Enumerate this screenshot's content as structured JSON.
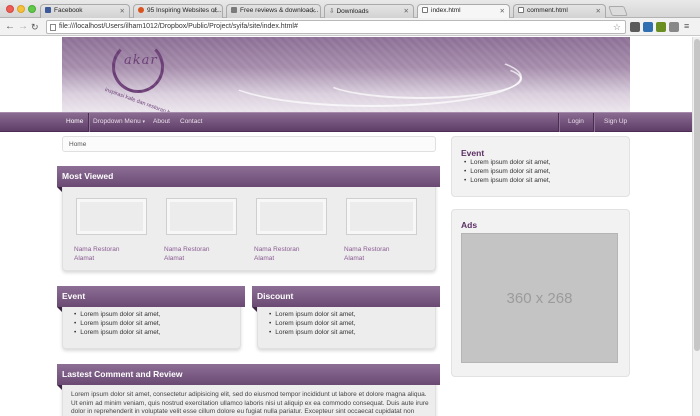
{
  "browser": {
    "tabs": [
      {
        "label": "Facebook",
        "icon": "facebook-icon",
        "color": "#3b5998"
      },
      {
        "label": "95 Inspiring Websites of...",
        "icon": "web-icon",
        "color": "#d9531e"
      },
      {
        "label": "Free reviews & download...",
        "icon": "web-icon",
        "color": "#7a7a7a"
      },
      {
        "label": "Downloads",
        "icon": "download-icon",
        "color": "#555555"
      },
      {
        "label": "index.html",
        "icon": "page-icon",
        "color": "#777777"
      },
      {
        "label": "comment.html",
        "icon": "page-icon",
        "color": "#777777"
      }
    ],
    "url": "file:///localhost/Users/ilham1012/Dropbox/Public/Project/syifa/site/index.html#"
  },
  "site": {
    "logo_text": "akar",
    "logo_tagline": "inspirasi kafe dan restoran bandung",
    "nav": {
      "home": "Home",
      "dropdown": "Dropdown Menu",
      "about": "About",
      "contact": "Contact",
      "login": "Login",
      "signup": "Sign Up"
    },
    "breadcrumb": "Home",
    "most_viewed": {
      "title": "Most Viewed",
      "items": [
        {
          "name": "Nama Restoran",
          "address": "Alamat"
        },
        {
          "name": "Nama Restoran",
          "address": "Alamat"
        },
        {
          "name": "Nama Restoran",
          "address": "Alamat"
        },
        {
          "name": "Nama Restoran",
          "address": "Alamat"
        }
      ]
    },
    "event": {
      "title": "Event",
      "items": [
        "Lorem ipsum dolor sit amet,",
        "Lorem ipsum dolor sit amet,",
        "Lorem ipsum dolor sit amet,"
      ]
    },
    "discount": {
      "title": "Discount",
      "items": [
        "Lorem ipsum dolor sit amet,",
        "Lorem ipsum dolor sit amet,",
        "Lorem ipsum dolor sit amet,"
      ]
    },
    "latest": {
      "title": "Lastest Comment and Review",
      "text": "Lorem ipsum dolor sit amet, consectetur adipisicing elit, sed do eiusmod tempor incididunt ut labore et dolore magna aliqua. Ut enim ad minim veniam, quis nostrud exercitation ullamco laboris nisi ut aliquip ex ea commodo consequat. Duis aute irure dolor in reprehenderit in voluptate velit esse cillum dolore eu fugiat nulla pariatur. Excepteur sint occaecat cupidatat non"
    },
    "sidebar_event": {
      "title": "Event",
      "items": [
        "Lorem ipsum dolor sit amet,",
        "Lorem ipsum dolor sit amet,",
        "Lorem ipsum dolor sit amet,"
      ]
    },
    "ads": {
      "title": "Ads",
      "placeholder": "360 x 268"
    }
  },
  "colors": {
    "brand_purple": "#6a4a73",
    "link_purple": "#8a5b92"
  }
}
